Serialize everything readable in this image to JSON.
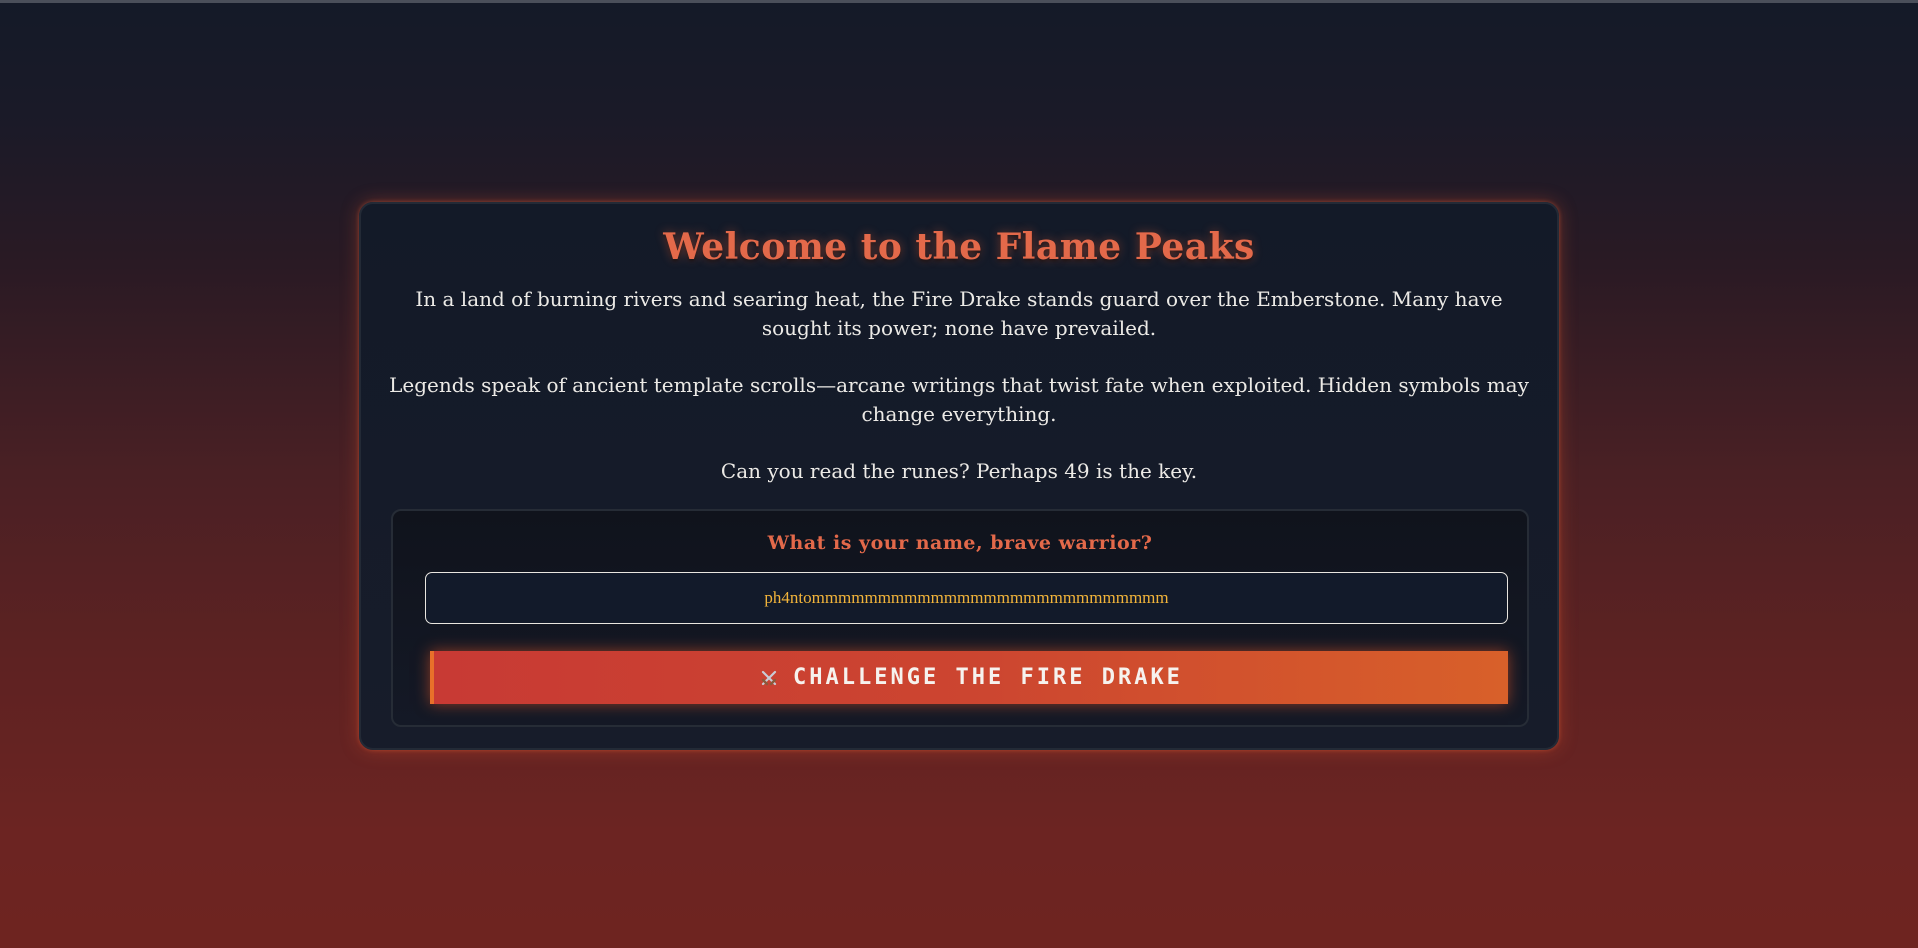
{
  "page": {
    "title": "Welcome to the Flame Peaks",
    "paragraphs": [
      "In a land of burning rivers and searing heat, the Fire Drake stands guard over the Emberstone. Many have sought its power; none have prevailed.",
      "Legends speak of ancient template scrolls—arcane writings that twist fate when exploited. Hidden symbols may change everything.",
      "Can you read the runes? Perhaps 49 is the key."
    ]
  },
  "form": {
    "prompt": "What is your name, brave warrior?",
    "name_value": "ph4ntommmmmmmmmmmmmmmmmmmmmmmmmmm",
    "button_icon": "crossed-swords-icon",
    "button_label": "CHALLENGE THE FIRE DRAKE"
  },
  "colors": {
    "accent": "#e3694a",
    "input_text": "#f2b43a",
    "button_start": "#c83a34",
    "button_end": "#d8602a"
  }
}
